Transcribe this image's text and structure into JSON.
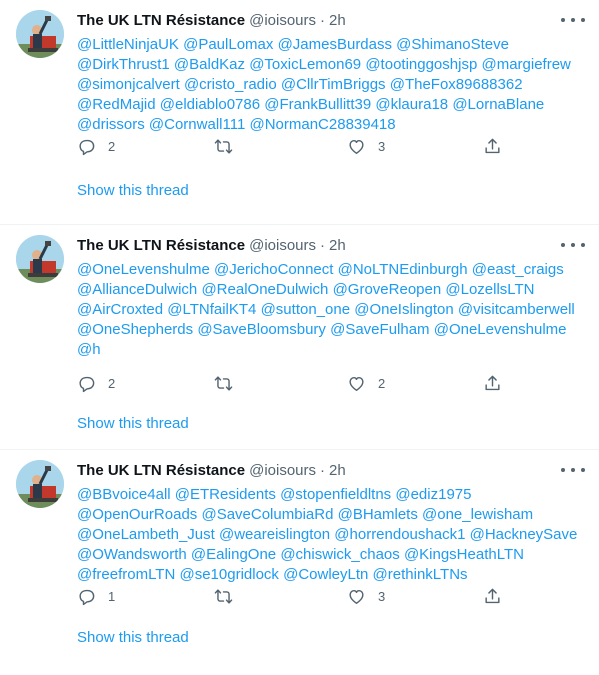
{
  "colors": {
    "link": "#1d9bf0",
    "secondary": "#536471",
    "text": "#0f1419",
    "divider": "#eff3f4"
  },
  "icons": {
    "reply": "reply-icon",
    "retweet": "retweet-icon",
    "like": "heart-icon",
    "share": "share-icon",
    "more": "more-icon"
  },
  "tweets": [
    {
      "name": "The UK LTN Résistance",
      "handle": "@ioisours",
      "separator": "·",
      "time": "2h",
      "mentions": [
        "@LittleNinjaUK",
        "@PaulLomax",
        "@JamesBurdass",
        "@ShimanoSteve",
        "@DirkThrust1",
        "@BaldKaz",
        "@ToxicLemon69",
        "@tootinggoshjsp",
        "@margiefrew",
        "@simonjcalvert",
        "@cristo_radio",
        "@CllrTimBriggs",
        "@TheFox89688362",
        "@RedMajid",
        "@eldiablo0786",
        "@FrankBullitt39",
        "@klaura18",
        "@LornaBlane",
        "@drissors",
        "@Cornwall111",
        "@NormanC28839418"
      ],
      "replies": "2",
      "retweets": "",
      "likes": "3",
      "thread_link": "Show this thread"
    },
    {
      "name": "The UK LTN Résistance",
      "handle": "@ioisours",
      "separator": "·",
      "time": "2h",
      "mentions": [
        "@OneLevenshulme",
        "@JerichoConnect",
        "@NoLTNEdinburgh",
        "@east_craigs",
        "@AllianceDulwich",
        "@RealOneDulwich",
        "@GroveReopen",
        "@LozellsLTN",
        "@AirCroxted",
        "@LTNfailKT4",
        "@sutton_one",
        " @OneIslington",
        "@visitcamberwell",
        "@OneShepherds",
        "@SaveBloomsbury",
        "@SaveFulham",
        "@OneLevenshulme",
        "@h"
      ],
      "replies": "2",
      "retweets": "",
      "likes": "2",
      "thread_link": "Show this thread"
    },
    {
      "name": "The UK LTN Résistance",
      "handle": "@ioisours",
      "separator": "·",
      "time": "2h",
      "mentions": [
        "@BBvoice4all",
        "@ETResidents",
        "@stopenfieldltns",
        "@ediz1975",
        "@OpenOurRoads",
        "@SaveColumbiaRd",
        "@BHamlets",
        "@one_lewisham",
        "@OneLambeth_Just",
        "@weareislington",
        "@horrendoushack1",
        "@HackneySave",
        "@OWandsworth",
        "@EalingOne",
        "@chiswick_chaos",
        "@KingsHeathLTN",
        "@freefromLTN",
        "@se10gridlock",
        "@CowleyLtn",
        "@rethinkLTNs"
      ],
      "replies": "1",
      "retweets": "",
      "likes": "3",
      "thread_link": "Show this thread"
    }
  ]
}
